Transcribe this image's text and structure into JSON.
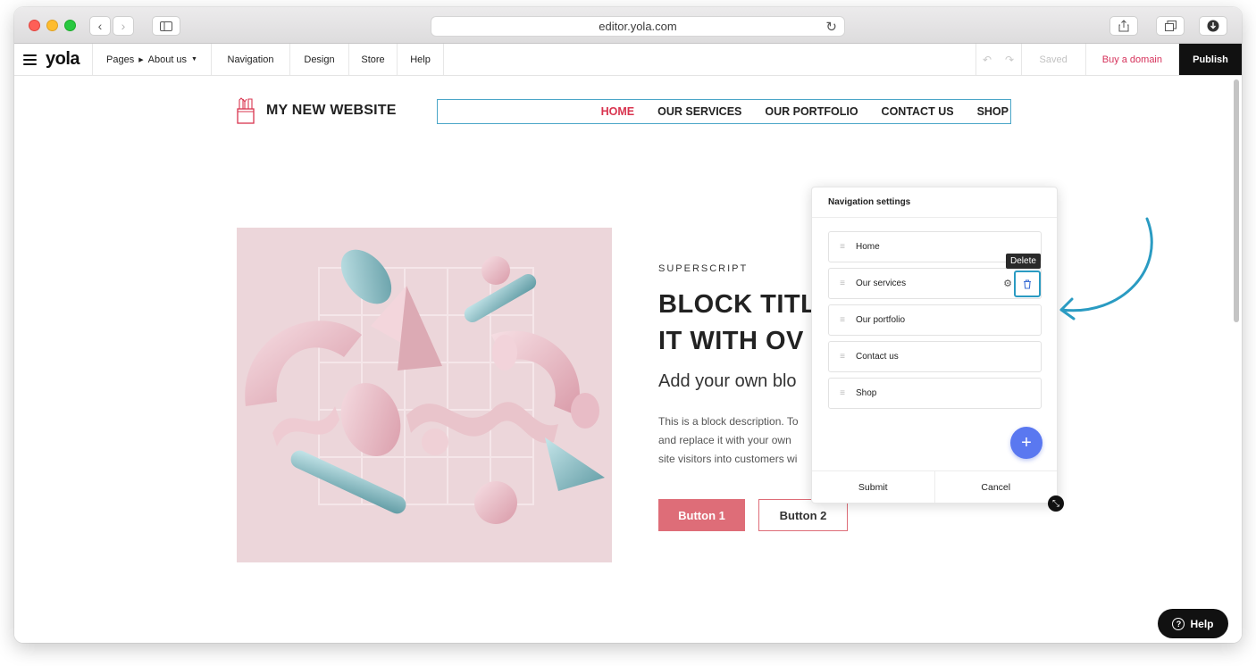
{
  "browser": {
    "url": "editor.yola.com",
    "icons": [
      "back-icon",
      "forward-icon",
      "sidebar-icon",
      "reload-icon",
      "share-icon",
      "tabs-icon",
      "download-icon"
    ]
  },
  "toolbar": {
    "logo": "yola",
    "pages_label": "Pages",
    "current_page": "About us",
    "items": [
      "Navigation",
      "Design",
      "Store",
      "Help"
    ],
    "saved_label": "Saved",
    "buy_domain_label": "Buy a domain",
    "publish_label": "Publish",
    "accent_color": "#d6325b"
  },
  "site": {
    "title": "MY NEW WEBSITE",
    "nav": [
      "HOME",
      "OUR SERVICES",
      "OUR PORTFOLIO",
      "CONTACT US",
      "SHOP"
    ],
    "active_nav": "HOME",
    "active_color": "#d9344f"
  },
  "block": {
    "superscript": "SUPERSCRIPT",
    "title_line1": "BLOCK TITL",
    "title_line2": "IT WITH OV",
    "subtitle": "Add your own blo",
    "desc_line1": "This is a block description. To",
    "desc_line2": "and replace it with your own",
    "desc_line3": "site visitors into customers wi",
    "button1": "Button 1",
    "button2": "Button 2",
    "button_color": "#de6d78"
  },
  "panel": {
    "title": "Navigation settings",
    "items": [
      "Home",
      "Our services",
      "Our portfolio",
      "Contact us",
      "Shop"
    ],
    "tooltip": "Delete",
    "submit_label": "Submit",
    "cancel_label": "Cancel",
    "add_color": "#5a78f0",
    "highlight_color": "#2a9bc2"
  },
  "help_label": "Help"
}
